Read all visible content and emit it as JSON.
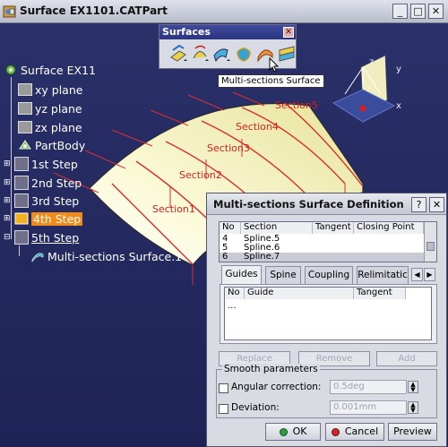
{
  "window": {
    "title": "Surface EX1101.CATPart"
  },
  "window_controls": {
    "minimize": "_",
    "maximize": "□",
    "close": "✕"
  },
  "tree": {
    "root": "Surface EX11",
    "items": [
      {
        "label": "xy plane",
        "icon": "plane-icon"
      },
      {
        "label": "yz plane",
        "icon": "plane-icon"
      },
      {
        "label": "zx plane",
        "icon": "plane-icon"
      },
      {
        "label": "PartBody",
        "icon": "partbody-icon"
      },
      {
        "label": "1st Step",
        "icon": "geometrical-set-icon"
      },
      {
        "label": "2nd Step",
        "icon": "geometrical-set-icon"
      },
      {
        "label": "3rd Step",
        "icon": "geometrical-set-icon"
      },
      {
        "label": "4th Step",
        "icon": "geometrical-set-icon",
        "highlighted": true
      },
      {
        "label": "5th Step",
        "icon": "geometrical-set-icon",
        "underlined": true
      },
      {
        "label": "Multi-sections Surface.1",
        "icon": "multi-sections-surface-icon"
      }
    ]
  },
  "toolbar": {
    "title": "Surfaces",
    "close": "✕",
    "buttons": [
      "extrude-icon",
      "revolve-icon",
      "sweep-icon",
      "fill-icon",
      "multi-sections-surface-icon",
      "blend-icon"
    ]
  },
  "tooltip": "Multi-sections Surface",
  "geometry": {
    "sections": [
      "Section1",
      "Section2",
      "Section3",
      "Section4",
      "Section5"
    ],
    "axes": {
      "z": "z",
      "y": "y",
      "x": "x"
    }
  },
  "dialog": {
    "title": "Multi-sections Surface Definition",
    "help": "?",
    "close": "✕",
    "sections_table": {
      "headers": [
        "No",
        "Section",
        "Tangent",
        "Closing Point"
      ],
      "rows": [
        {
          "no": "4",
          "section": "Spline.5"
        },
        {
          "no": "5",
          "section": "Spline.6"
        },
        {
          "no": "6",
          "section": "Spline.7",
          "selected": true
        }
      ]
    },
    "tabs": [
      "Guides",
      "Spine",
      "Coupling",
      "Relimitatic"
    ],
    "active_tab": "Guides",
    "guides_table": {
      "headers": [
        "No",
        "Guide",
        "Tangent"
      ],
      "rows": [
        {
          "no": "..."
        }
      ]
    },
    "buttons": {
      "replace": "Replace",
      "remove": "Remove",
      "add": "Add"
    },
    "smooth": {
      "group_label": "Smooth parameters",
      "angular_label": "Angular correction:",
      "angular_value": "0.5deg",
      "deviation_label": "Deviation:",
      "deviation_value": "0.001mm"
    },
    "footer": {
      "ok": "OK",
      "cancel": "Cancel",
      "preview": "Preview"
    }
  },
  "colors": {
    "background": "#262c63",
    "surface": "#f4f2b8",
    "section": "#d83030",
    "highlight": "#f08a18"
  }
}
